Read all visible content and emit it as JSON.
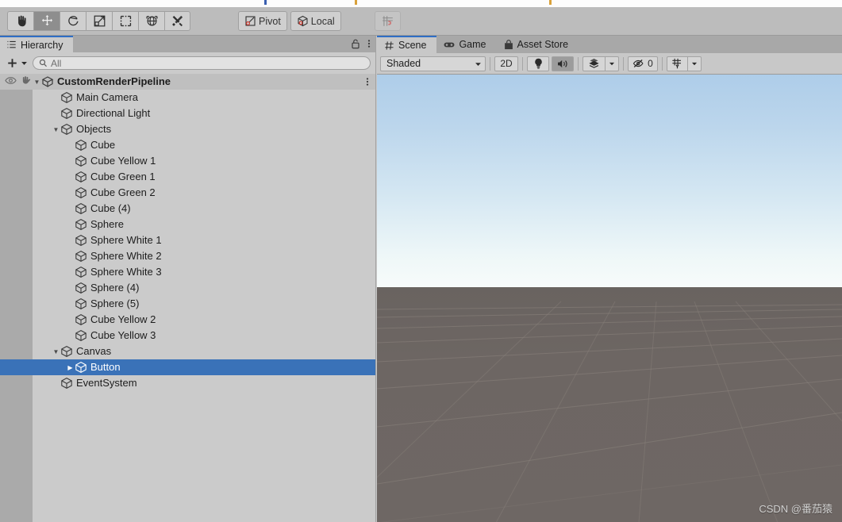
{
  "toolbar": {
    "tools": [
      {
        "name": "hand-tool",
        "icon": "hand",
        "active": false
      },
      {
        "name": "move-tool",
        "icon": "move",
        "active": true
      },
      {
        "name": "rotate-tool",
        "icon": "rotate",
        "active": false
      },
      {
        "name": "scale-tool",
        "icon": "scale",
        "active": false
      },
      {
        "name": "rect-tool",
        "icon": "rect",
        "active": false
      },
      {
        "name": "transform-tool",
        "icon": "transform",
        "active": false
      },
      {
        "name": "custom-tool",
        "icon": "wrench",
        "active": false
      }
    ],
    "pivot_label": "Pivot",
    "local_label": "Local",
    "grid_snap_label": ""
  },
  "hierarchy": {
    "tab_label": "Hierarchy",
    "add_label": "",
    "search": {
      "value": "",
      "placeholder": "All"
    },
    "items": [
      {
        "label": "CustomRenderPipeline",
        "depth": 0,
        "root": true,
        "arrow": "down",
        "selected": false
      },
      {
        "label": "Main Camera",
        "depth": 2,
        "root": false,
        "arrow": "none",
        "selected": false
      },
      {
        "label": "Directional Light",
        "depth": 2,
        "root": false,
        "arrow": "none",
        "selected": false
      },
      {
        "label": "Objects",
        "depth": 2,
        "root": false,
        "arrow": "down",
        "selected": false
      },
      {
        "label": "Cube",
        "depth": 3,
        "root": false,
        "arrow": "none",
        "selected": false
      },
      {
        "label": "Cube Yellow 1",
        "depth": 3,
        "root": false,
        "arrow": "none",
        "selected": false
      },
      {
        "label": "Cube Green 1",
        "depth": 3,
        "root": false,
        "arrow": "none",
        "selected": false
      },
      {
        "label": "Cube Green 2",
        "depth": 3,
        "root": false,
        "arrow": "none",
        "selected": false
      },
      {
        "label": "Cube (4)",
        "depth": 3,
        "root": false,
        "arrow": "none",
        "selected": false
      },
      {
        "label": "Sphere",
        "depth": 3,
        "root": false,
        "arrow": "none",
        "selected": false
      },
      {
        "label": "Sphere White 1",
        "depth": 3,
        "root": false,
        "arrow": "none",
        "selected": false
      },
      {
        "label": "Sphere White 2",
        "depth": 3,
        "root": false,
        "arrow": "none",
        "selected": false
      },
      {
        "label": "Sphere White 3",
        "depth": 3,
        "root": false,
        "arrow": "none",
        "selected": false
      },
      {
        "label": "Sphere (4)",
        "depth": 3,
        "root": false,
        "arrow": "none",
        "selected": false
      },
      {
        "label": "Sphere (5)",
        "depth": 3,
        "root": false,
        "arrow": "none",
        "selected": false
      },
      {
        "label": "Cube Yellow 2",
        "depth": 3,
        "root": false,
        "arrow": "none",
        "selected": false
      },
      {
        "label": "Cube Yellow 3",
        "depth": 3,
        "root": false,
        "arrow": "none",
        "selected": false
      },
      {
        "label": "Canvas",
        "depth": 2,
        "root": false,
        "arrow": "down",
        "selected": false
      },
      {
        "label": "Button",
        "depth": 3,
        "root": false,
        "arrow": "right",
        "selected": true
      },
      {
        "label": "EventSystem",
        "depth": 2,
        "root": false,
        "arrow": "none",
        "selected": false
      }
    ]
  },
  "scene_panel": {
    "tabs": [
      {
        "label": "Scene",
        "icon": "grid-icon",
        "active": true
      },
      {
        "label": "Game",
        "icon": "gamepad-icon",
        "active": false
      },
      {
        "label": "Asset Store",
        "icon": "shop-icon",
        "active": false
      }
    ],
    "draw_mode": "Shaded",
    "two_d_label": "2D",
    "lighting_on": true,
    "audio_on": true,
    "effects_label": "",
    "hidden_count": "0",
    "grid_label": "",
    "watermark": "CSDN @番茄猿"
  }
}
